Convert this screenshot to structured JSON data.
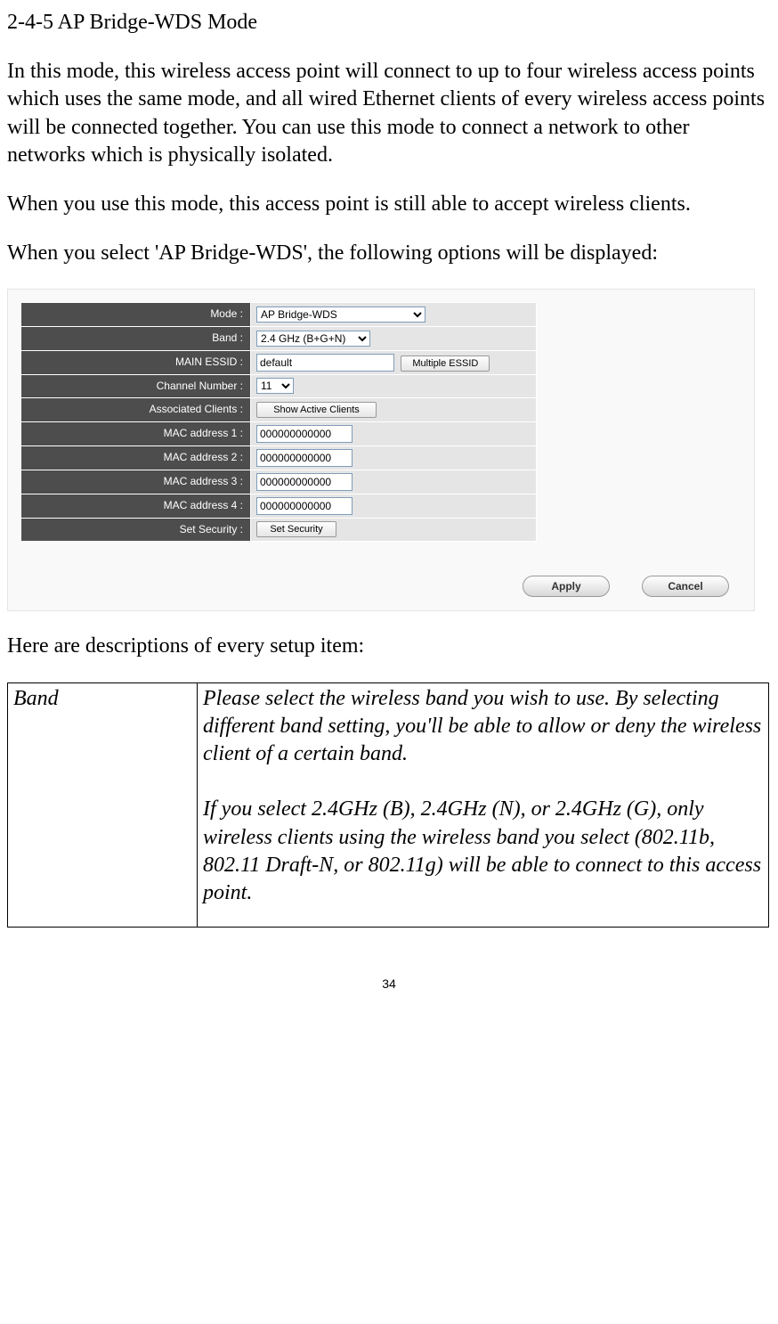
{
  "section_title": "2-4-5 AP Bridge-WDS Mode",
  "paragraphs": {
    "p1": "In this mode, this wireless access point will connect to up to four wireless access points which uses the same mode, and all wired Ethernet clients of every wireless access points will be connected together. You can use this mode to connect a network to other networks which is physically isolated.",
    "p2": "When you use this mode, this access point is still able to accept wireless clients.",
    "p3": "When you select 'AP Bridge-WDS', the following options will be displayed:",
    "p4": "Here are descriptions of every setup item:"
  },
  "form": {
    "rows": {
      "mode": {
        "label": "Mode :",
        "value": "AP Bridge-WDS"
      },
      "band": {
        "label": "Band :",
        "value": "2.4 GHz (B+G+N)"
      },
      "essid": {
        "label": "MAIN ESSID :",
        "value": "default",
        "multi_btn": "Multiple ESSID"
      },
      "chan": {
        "label": "Channel Number :",
        "value": "11"
      },
      "assoc": {
        "label": "Associated Clients :",
        "btn": "Show Active Clients"
      },
      "mac1": {
        "label": "MAC address 1 :",
        "value": "000000000000"
      },
      "mac2": {
        "label": "MAC address 2 :",
        "value": "000000000000"
      },
      "mac3": {
        "label": "MAC address 3 :",
        "value": "000000000000"
      },
      "mac4": {
        "label": "MAC address 4 :",
        "value": "000000000000"
      },
      "sec": {
        "label": "Set Security :",
        "btn": "Set Security"
      }
    },
    "apply": "Apply",
    "cancel": "Cancel"
  },
  "desc_table": {
    "col_name": "Band",
    "col_desc_a": "Please select the wireless band you wish to use. By selecting different band setting, you'll be able to allow or deny the wireless client of a certain band.",
    "col_desc_b": "If you select 2.4GHz (B), 2.4GHz (N), or 2.4GHz (G), only wireless clients using the wireless band you select (802.11b, 802.11 Draft-N, or 802.11g) will be able to connect to this access point."
  },
  "page_number": "34"
}
